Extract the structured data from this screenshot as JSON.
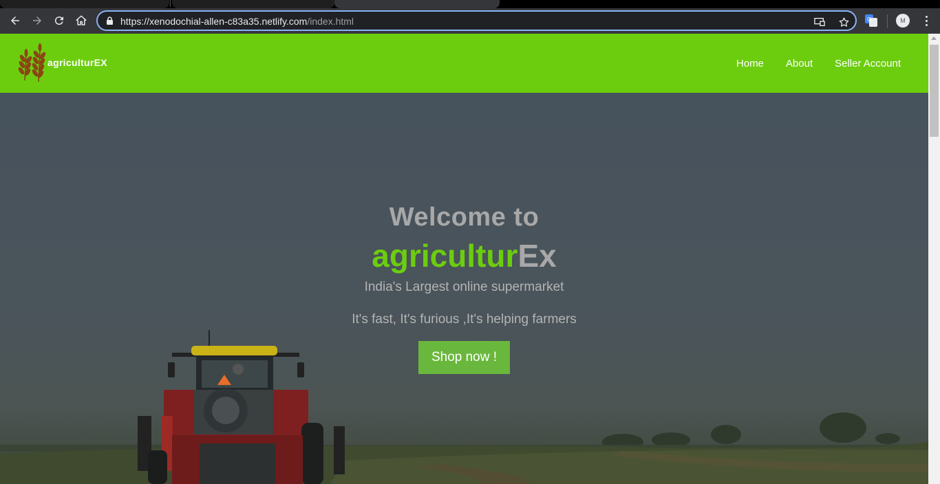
{
  "browser": {
    "url_host": "https://xenodochial-allen-c83a35.netlify.com",
    "url_path": "/index.html",
    "avatar_initial": "M"
  },
  "site": {
    "brand": "agriculturEX",
    "nav": [
      "Home",
      "About",
      "Seller Account"
    ],
    "colors": {
      "brand_green": "#6ccd0f",
      "button_green": "#6ab73d",
      "leaf_brown": "#8b4513"
    }
  },
  "hero": {
    "welcome": "Welcome to",
    "brand_green": "agricultur",
    "brand_grey": "Ex",
    "tagline": "India's Largest online supermarket",
    "tagline2": "It's fast, It's furious ,It's helping farmers",
    "cta": "Shop now !"
  }
}
